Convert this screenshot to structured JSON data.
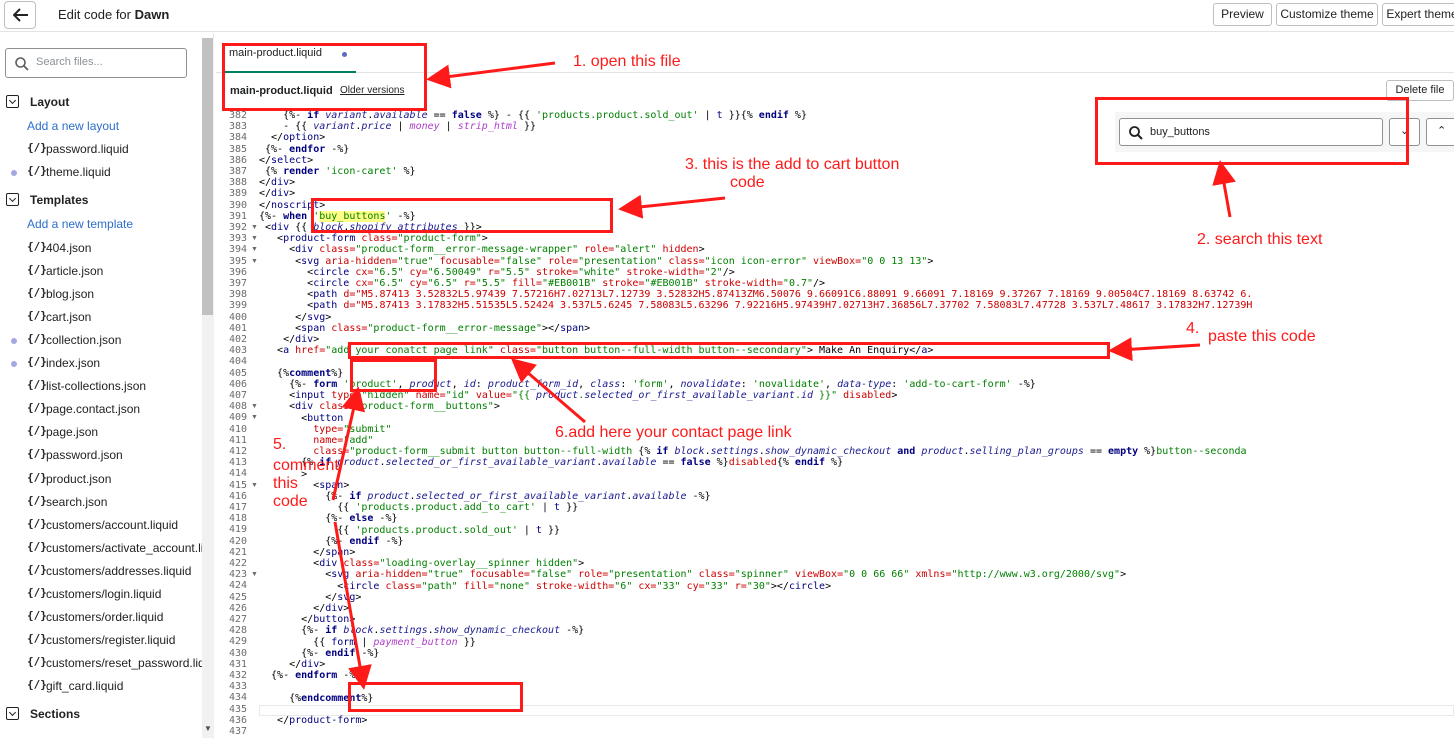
{
  "topbar": {
    "title_prefix": "Edit code for",
    "theme_name": "Dawn",
    "preview": "Preview",
    "customize": "Customize theme",
    "expert": "Expert theme"
  },
  "sidebar": {
    "search_placeholder": "Search files...",
    "layout_title": "Layout",
    "add_layout": "Add a new layout",
    "layout_files": [
      "password.liquid",
      "theme.liquid"
    ],
    "templates_title": "Templates",
    "add_template": "Add a new template",
    "template_files": [
      "404.json",
      "article.json",
      "blog.json",
      "cart.json",
      "collection.json",
      "index.json",
      "list-collections.json",
      "page.contact.json",
      "page.json",
      "password.json",
      "product.json",
      "search.json",
      "customers/account.liquid",
      "customers/activate_account.liquid",
      "customers/addresses.liquid",
      "customers/login.liquid",
      "customers/order.liquid",
      "customers/register.liquid",
      "customers/reset_password.liquid",
      "gift_card.liquid"
    ],
    "sections_title": "Sections",
    "file_icon": "{/}"
  },
  "editor": {
    "tab_label": "main-product.liquid",
    "file_name": "main-product.liquid",
    "older_versions": "Older versions",
    "delete_file": "Delete file",
    "search_value": "buy_buttons"
  },
  "line_numbers": [
    "382",
    "383",
    "384",
    "385",
    "386",
    "387",
    "388",
    "389",
    "390",
    "391",
    "392",
    "393",
    "394",
    "395",
    "396",
    "397",
    "398",
    "399",
    "400",
    "401",
    "402",
    "403",
    "404",
    "405",
    "406",
    "407",
    "408",
    "409",
    "410",
    "411",
    "412",
    "413",
    "414",
    "415",
    "416",
    "417",
    "418",
    "419",
    "420",
    "421",
    "422",
    "423",
    "424",
    "425",
    "426",
    "427",
    "428",
    "429",
    "430",
    "431",
    "432",
    "433",
    "434",
    "435",
    "436",
    "437"
  ],
  "annotations": {
    "a1": "1. open this file",
    "a2": "2. search this text",
    "a3_line1": "3. this is the add to cart button",
    "a3_line2": "code",
    "a4": "4.",
    "a4b": "paste this code",
    "a5_line1": "5.",
    "a5_line2": "comment",
    "a5_line3": "this",
    "a5_line4": "code",
    "a6": "6.add here your contact page link"
  },
  "colors": {
    "annotation_red": "#ff1a1a",
    "link_blue": "#2c6ecb",
    "active_tab": "#008060"
  }
}
